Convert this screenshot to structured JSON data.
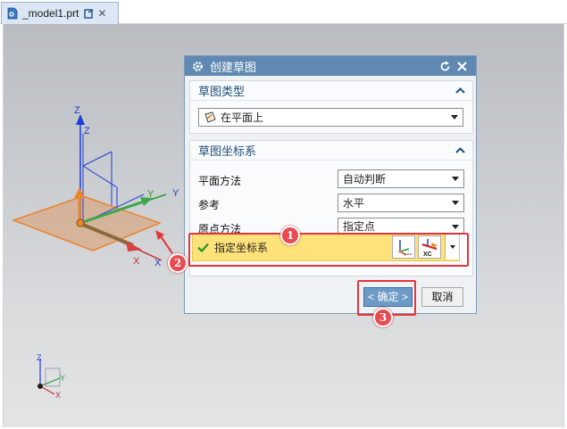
{
  "tab": {
    "title": "_model1.prt",
    "close": "✕"
  },
  "dialog": {
    "title": "创建草图",
    "sketch_type": {
      "heading": "草图类型",
      "value": "在平面上"
    },
    "sketch_csys": {
      "heading": "草图坐标系",
      "rows": [
        {
          "label": "平面方法",
          "value": "自动判断"
        },
        {
          "label": "参考",
          "value": "水平"
        },
        {
          "label": "原点方法",
          "value": "指定点"
        }
      ],
      "specify_csys_label": "指定坐标系"
    },
    "ok_label": "< 确定 >",
    "cancel_label": "取消"
  },
  "viewport": {
    "axis_labels": {
      "z": "Z",
      "zc": "Z",
      "y": "Y",
      "yc": "Y",
      "x": "X",
      "xc": "X"
    },
    "mini_triad": {
      "z": "Z",
      "y": "Y",
      "x": "X"
    }
  },
  "toolbar_icon_label": "XC",
  "callouts": [
    "1",
    "2",
    "3"
  ],
  "colors": {
    "accent": "#5f89b3",
    "highlight_row": "#ffe27a",
    "callout": "#e8333b",
    "ok_button": "#6d9ac6"
  }
}
